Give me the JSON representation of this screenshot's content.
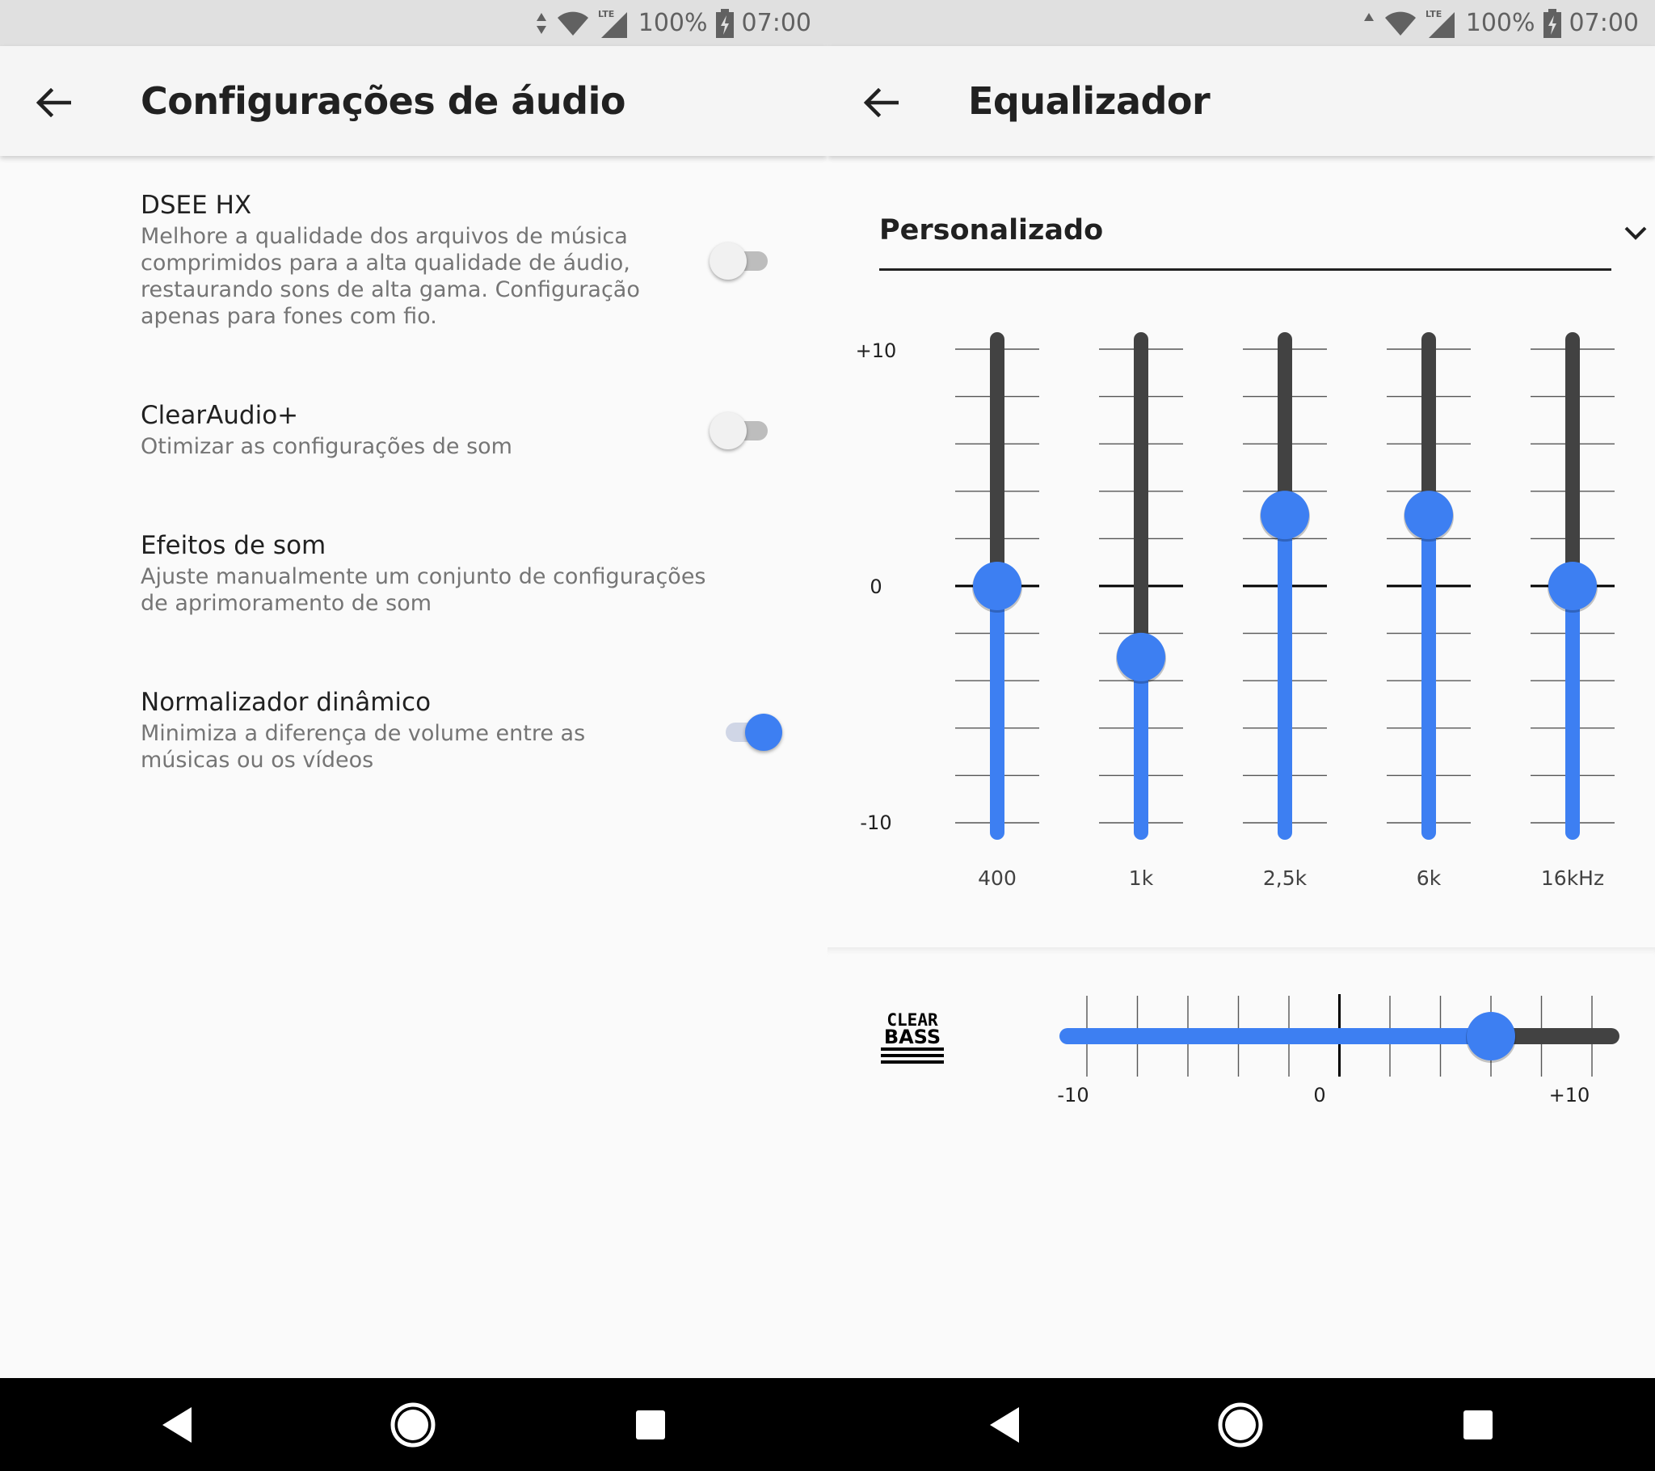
{
  "status_bar": {
    "battery": "100%",
    "time": "07:00",
    "network": "LTE"
  },
  "audio_settings": {
    "title": "Configurações de áudio",
    "items": [
      {
        "title": "DSEE HX",
        "description": "Melhore a qualidade dos arquivos de música comprimidos para a alta qualidade de áudio, restaurando sons de alta gama. Configuração apenas para fones com fio.",
        "enabled": false
      },
      {
        "title": "ClearAudio+",
        "description": "Otimizar as configurações de som",
        "enabled": false
      },
      {
        "title": "Efeitos de som",
        "description": "Ajuste manualmente um conjunto de configurações de aprimoramento de som"
      },
      {
        "title": "Normalizador dinâmico",
        "description": "Minimiza a diferença de volume entre as músicas ou os vídeos",
        "enabled": true
      }
    ]
  },
  "equalizer": {
    "title": "Equalizador",
    "preset": "Personalizado",
    "scale_labels": {
      "max": "+10",
      "zero": "0",
      "min": "-10"
    },
    "bands": [
      {
        "label": "400",
        "value": 0
      },
      {
        "label": "1k",
        "value": -3
      },
      {
        "label": "2,5k",
        "value": 3
      },
      {
        "label": "6k",
        "value": 3
      },
      {
        "label": "16kHz",
        "value": 0
      }
    ],
    "clear_bass": {
      "logo_top": "CLEAR",
      "logo_bottom": "BASS",
      "value": 6,
      "min_label": "-10",
      "zero_label": "0",
      "max_label": "+10"
    }
  },
  "colors": {
    "accent": "#3d7ff2",
    "track": "#424242"
  },
  "icons": [
    "back-arrow-icon",
    "chevron-down-icon",
    "wifi-icon",
    "signal-icon",
    "battery-icon",
    "nav-back-icon",
    "nav-home-icon",
    "nav-recents-icon"
  ]
}
